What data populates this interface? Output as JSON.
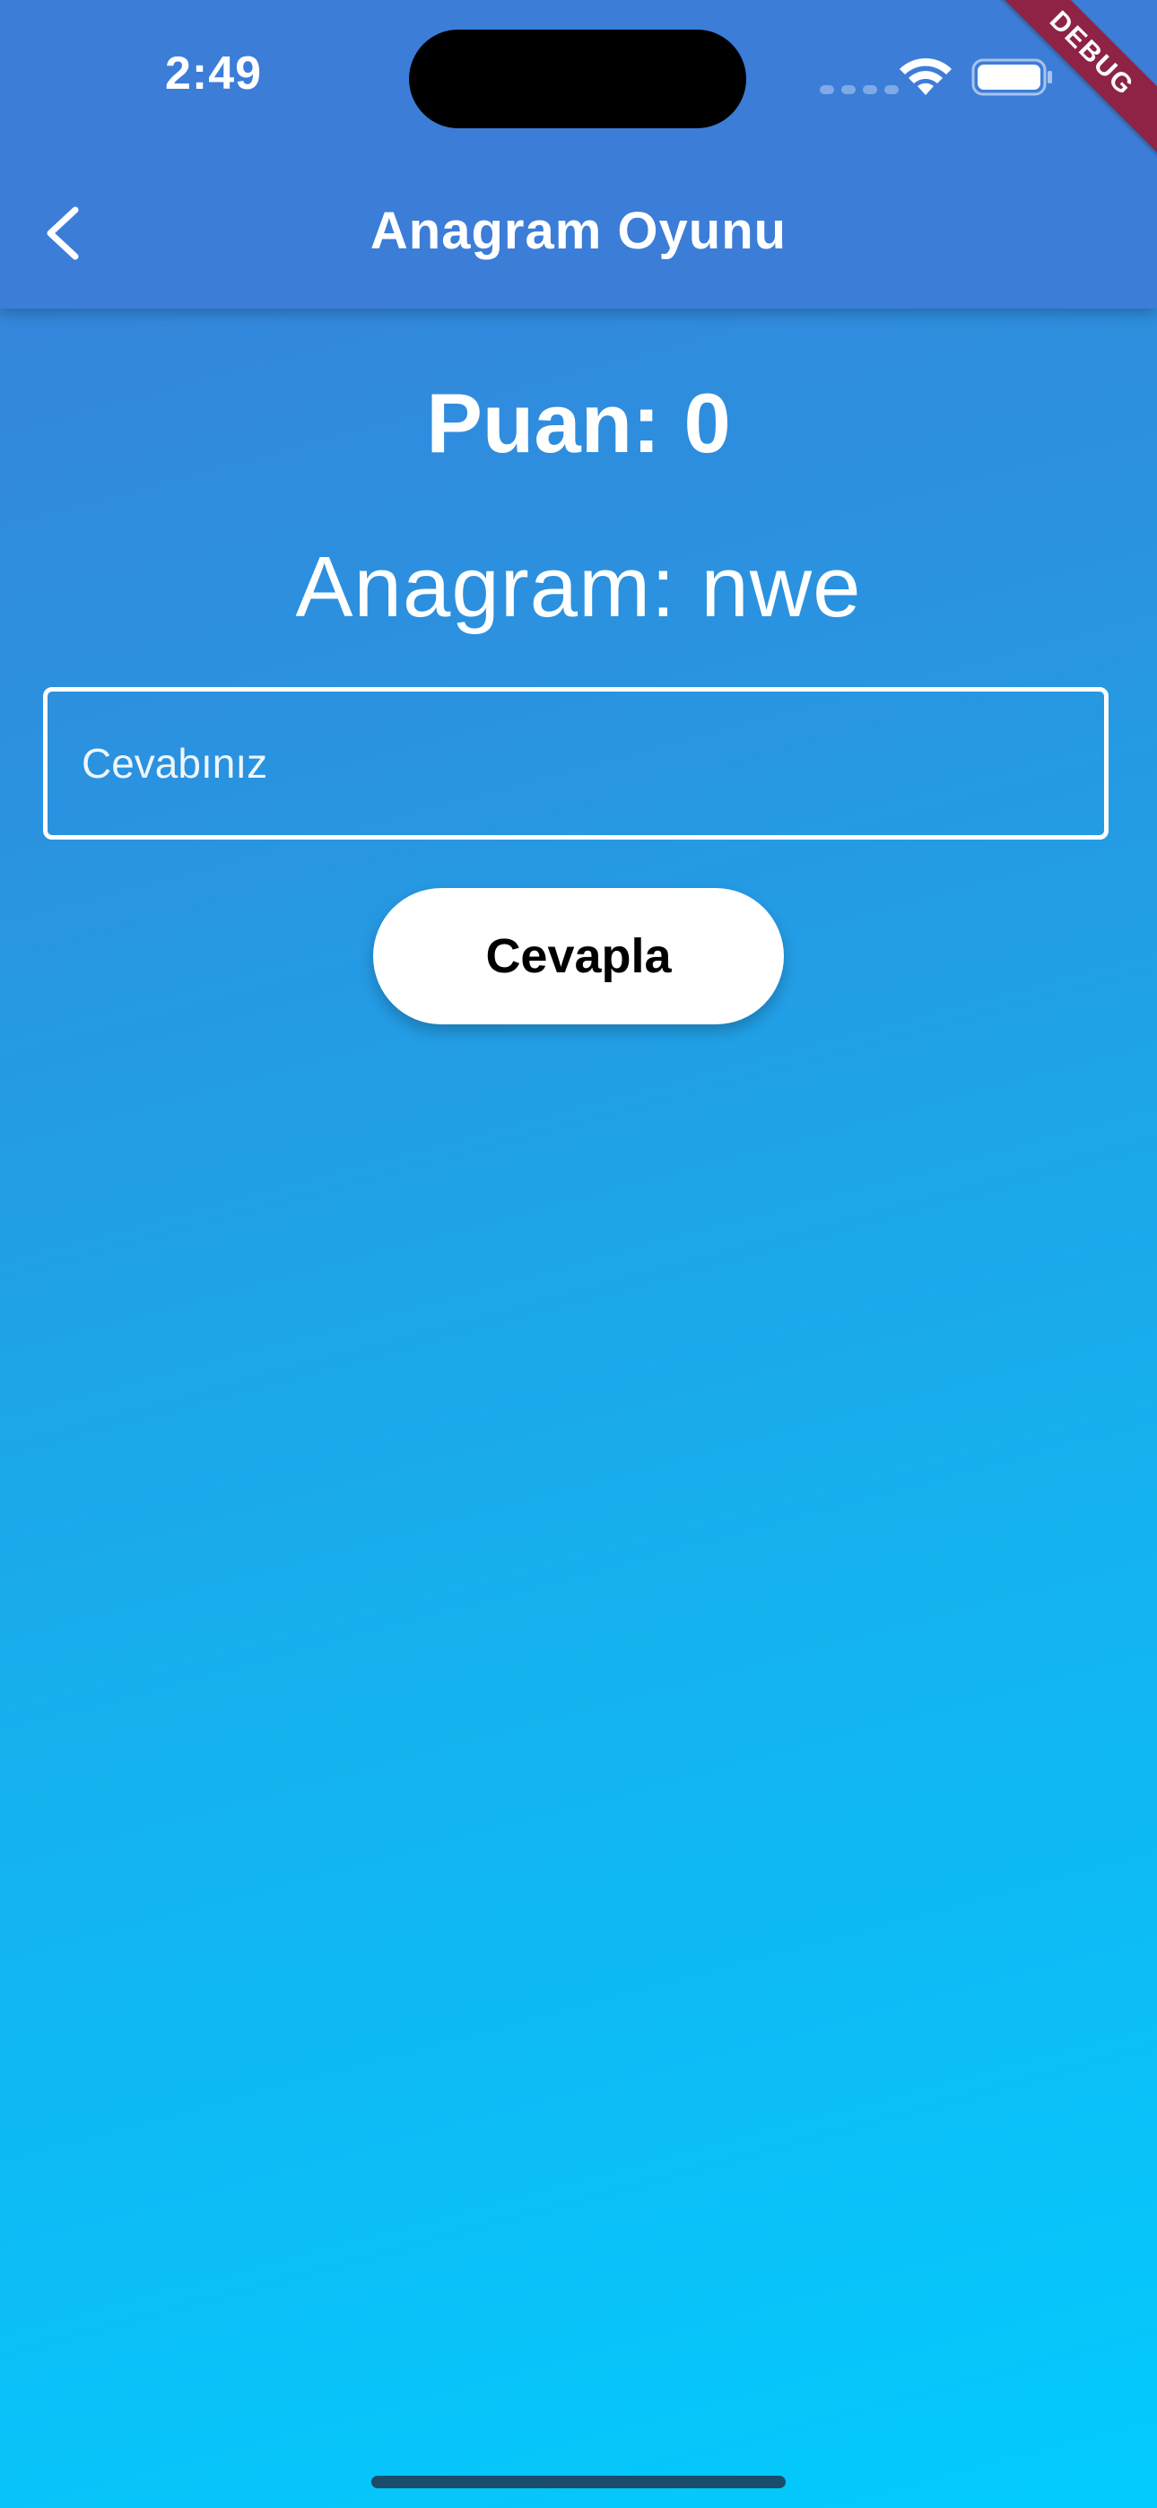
{
  "status_bar": {
    "time": "2:49"
  },
  "debug_banner": "DEBUG",
  "app_bar": {
    "title": "Anagram Oyunu",
    "back_icon": "chevron-left-icon"
  },
  "game": {
    "score_label": "Puan: 0",
    "anagram_label": "Anagram: nwe",
    "answer_field": {
      "placeholder": "Cevabınız",
      "value": ""
    },
    "submit_label": "Cevapla"
  },
  "colors": {
    "app_bar": "#3c7dd8",
    "gradient_top": "#3a7fd9",
    "gradient_bottom": "#02cbfd",
    "debug_ribbon": "#8e2346",
    "button_bg": "#ffffff",
    "button_text": "#000000"
  }
}
